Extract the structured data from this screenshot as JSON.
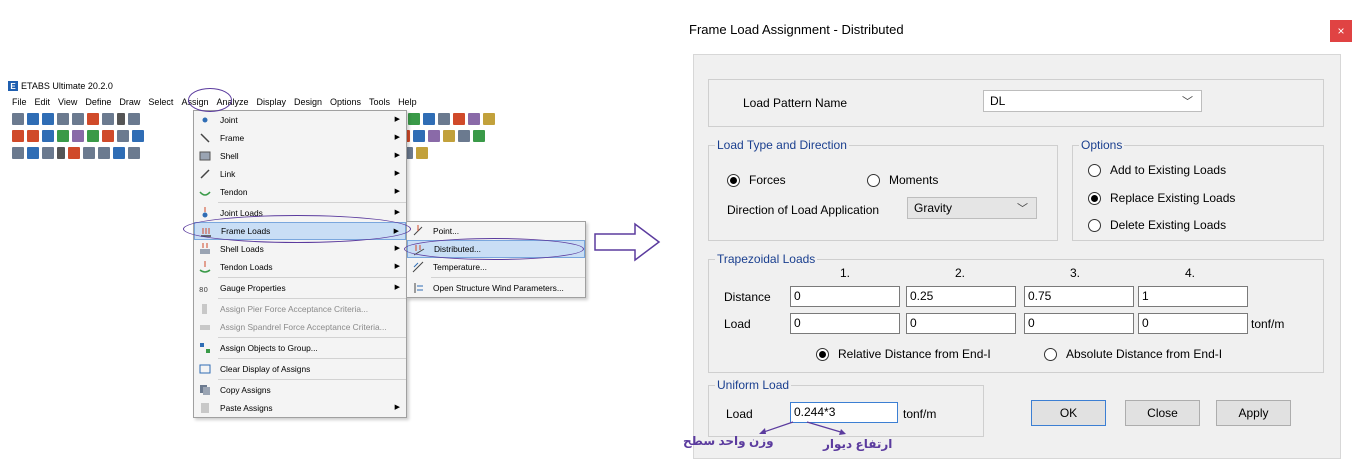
{
  "etabs": {
    "title": "ETABS Ultimate 20.2.0",
    "menu": [
      "File",
      "Edit",
      "View",
      "Define",
      "Draw",
      "Select",
      "Assign",
      "Analyze",
      "Display",
      "Design",
      "Options",
      "Tools",
      "Help"
    ]
  },
  "assign_menu": {
    "items": [
      {
        "label": "Joint",
        "icon": "joint-icon"
      },
      {
        "label": "Frame",
        "icon": "frame-icon"
      },
      {
        "label": "Shell",
        "icon": "shell-icon"
      },
      {
        "label": "Link",
        "icon": "link-icon"
      },
      {
        "label": "Tendon",
        "icon": "tendon-icon"
      },
      {
        "label": "Joint Loads",
        "icon": "joint-loads-icon"
      },
      {
        "label": "Frame Loads",
        "icon": "frame-loads-icon"
      },
      {
        "label": "Shell Loads",
        "icon": "shell-loads-icon"
      },
      {
        "label": "Tendon Loads",
        "icon": "tendon-loads-icon"
      },
      {
        "label": "Gauge Properties",
        "icon": "gauge-icon"
      },
      {
        "label": "Assign Pier Force Acceptance Criteria...",
        "icon": "pier-icon"
      },
      {
        "label": "Assign Spandrel Force Acceptance Criteria...",
        "icon": "spandrel-icon"
      },
      {
        "label": "Assign Objects to Group...",
        "icon": "group-icon"
      },
      {
        "label": "Clear Display of Assigns",
        "icon": "clear-icon"
      },
      {
        "label": "Copy Assigns",
        "icon": "copy-icon"
      },
      {
        "label": "Paste Assigns",
        "icon": "paste-icon"
      }
    ]
  },
  "frame_loads_submenu": {
    "items": [
      "Point...",
      "Distributed...",
      "Temperature...",
      "Open Structure Wind Parameters..."
    ]
  },
  "dialog": {
    "title": "Frame Load Assignment - Distributed",
    "close_glyph": "×",
    "load_pattern_label": "Load Pattern Name",
    "load_pattern_value": "DL",
    "load_type": {
      "legend": "Load Type and Direction",
      "forces": "Forces",
      "moments": "Moments",
      "direction_label": "Direction of Load Application",
      "direction_value": "Gravity"
    },
    "options": {
      "legend": "Options",
      "add": "Add to Existing Loads",
      "replace": "Replace Existing Loads",
      "delete": "Delete Existing Loads"
    },
    "trapezoidal": {
      "legend": "Trapezoidal Loads",
      "columns": [
        "1.",
        "2.",
        "3.",
        "4."
      ],
      "distance_label": "Distance",
      "load_label": "Load",
      "distances": [
        "0",
        "0.25",
        "0.75",
        "1"
      ],
      "loads": [
        "0",
        "0",
        "0",
        "0"
      ],
      "unit": "tonf/m",
      "relative": "Relative Distance from End-I",
      "absolute": "Absolute Distance from End-I"
    },
    "uniform": {
      "legend": "Uniform Load",
      "load_label": "Load",
      "value": "0.244*3",
      "unit": "tonf/m"
    },
    "buttons": {
      "ok": "OK",
      "close": "Close",
      "apply": "Apply"
    }
  },
  "annotations": {
    "unit_weight": "وزن واحد سطح",
    "wall_height": "ارتفاع دیوار"
  },
  "colors": {
    "annotation": "#5b3b9e",
    "close_button": "#e04343",
    "legend_text": "#1a3f8f",
    "highlight": "#c9def5"
  }
}
